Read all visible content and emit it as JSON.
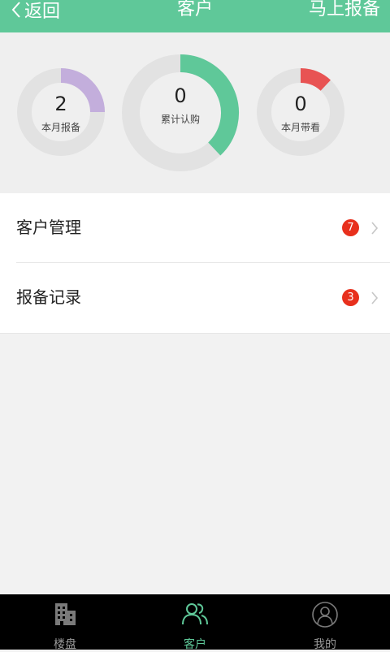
{
  "header": {
    "back_label": "返回",
    "title": "客户",
    "action_label": "马上报备"
  },
  "stats": [
    {
      "value": "2",
      "label": "本月报备",
      "fill_fraction": 0.25,
      "color": "#c3aedc"
    },
    {
      "value": "0",
      "label": "累计认购",
      "fill_fraction": 0.38,
      "color": "#5fc899"
    },
    {
      "value": "0",
      "label": "本月带看",
      "fill_fraction": 0.12,
      "color": "#e85353"
    }
  ],
  "menu": {
    "items": [
      {
        "label": "客户管理",
        "badge": "7"
      },
      {
        "label": "报备记录",
        "badge": "3"
      }
    ]
  },
  "tabbar": {
    "items": [
      {
        "label": "楼盘",
        "icon": "building-icon",
        "active": false
      },
      {
        "label": "客户",
        "icon": "customers-icon",
        "active": true
      },
      {
        "label": "我的",
        "icon": "profile-icon",
        "active": false
      }
    ]
  },
  "colors": {
    "accent": "#5fc899",
    "badge": "#e8301d",
    "track": "#e2e2e2"
  }
}
